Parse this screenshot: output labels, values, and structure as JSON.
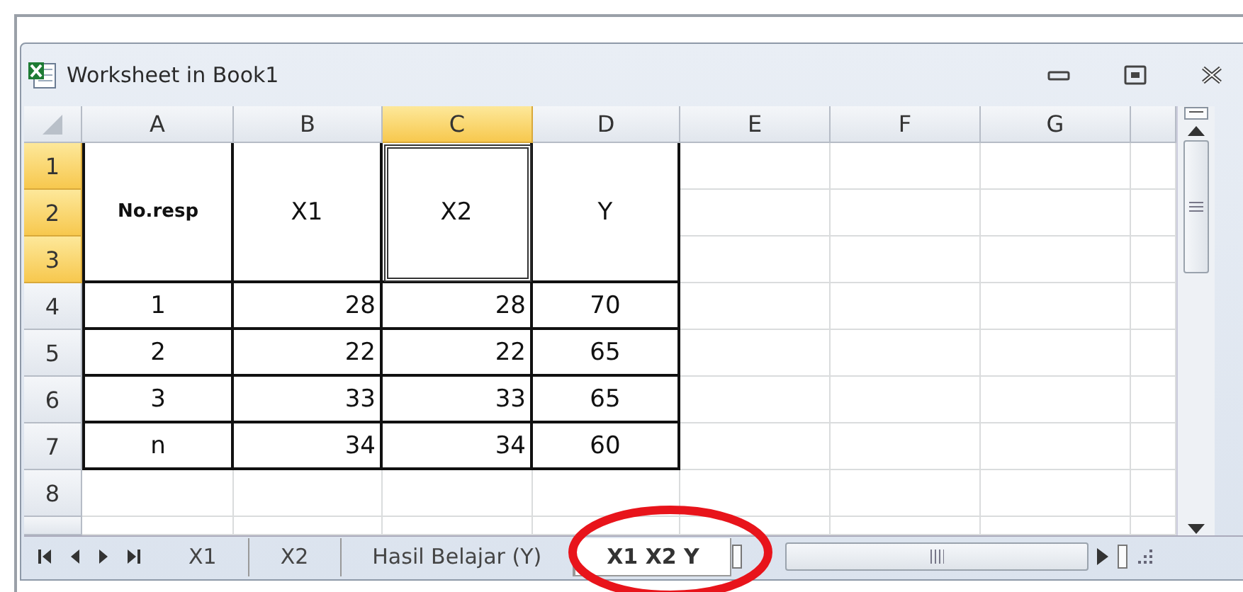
{
  "window": {
    "title": "Worksheet in Book1"
  },
  "columns": [
    {
      "label": "A",
      "selected": false
    },
    {
      "label": "B",
      "selected": false
    },
    {
      "label": "C",
      "selected": true
    },
    {
      "label": "D",
      "selected": false
    },
    {
      "label": "E",
      "selected": false
    },
    {
      "label": "F",
      "selected": false
    },
    {
      "label": "G",
      "selected": false
    }
  ],
  "rows": [
    {
      "label": "1",
      "selected": true
    },
    {
      "label": "2",
      "selected": true
    },
    {
      "label": "3",
      "selected": true
    },
    {
      "label": "4",
      "selected": false
    },
    {
      "label": "5",
      "selected": false
    },
    {
      "label": "6",
      "selected": false
    },
    {
      "label": "7",
      "selected": false
    },
    {
      "label": "8",
      "selected": false
    }
  ],
  "table": {
    "header": [
      {
        "text": "No.resp",
        "bold": true,
        "selected": false
      },
      {
        "text": "X1",
        "bold": false,
        "selected": false
      },
      {
        "text": "X2",
        "bold": false,
        "selected": true
      },
      {
        "text": "Y",
        "bold": false,
        "selected": false
      }
    ],
    "rows": [
      [
        "1",
        "28",
        "28",
        "70"
      ],
      [
        "2",
        "22",
        "22",
        "65"
      ],
      [
        "3",
        "33",
        "33",
        "65"
      ],
      [
        "n",
        "34",
        "34",
        "60"
      ]
    ]
  },
  "sheet_tabs": [
    {
      "label": "X1",
      "selected": false
    },
    {
      "label": "X2",
      "selected": false
    },
    {
      "label": "Hasil Belajar (Y)",
      "selected": false
    },
    {
      "label": "X1 X2 Y",
      "selected": true
    }
  ],
  "annotations": [
    {
      "kind": "ellipse",
      "color": "#e8141b"
    }
  ]
}
